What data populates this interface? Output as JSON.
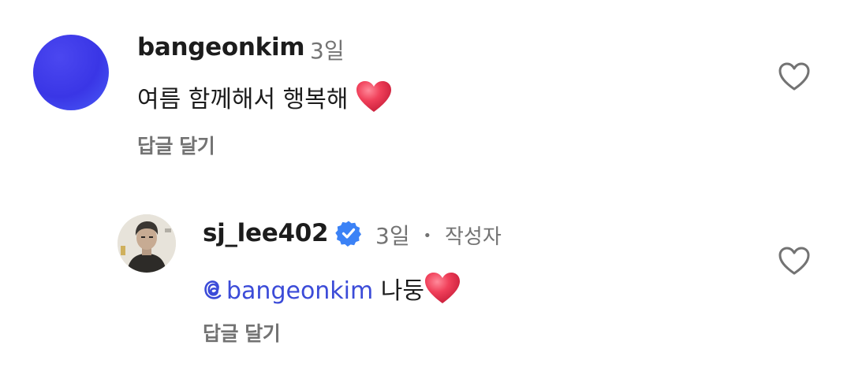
{
  "comments": [
    {
      "username": "bangeonkim",
      "time": "3일",
      "text": "여름 함께해서 행복해",
      "emoji": "heart",
      "reply_label": "답글 달기",
      "avatar_color": "#3b37e8"
    },
    {
      "username": "sj_lee402",
      "verified": true,
      "time": "3일",
      "separator": "•",
      "author_badge": "작성자",
      "mention": "bangeonkim",
      "text": "나둥",
      "emoji": "heart",
      "reply_label": "답글 달기"
    }
  ],
  "colors": {
    "mention": "#3b4bd8",
    "meta": "#737373",
    "verified": "#3b82f6",
    "heart_emoji": "#e8334a"
  },
  "icons": {
    "like": "heart-outline-icon",
    "verified": "verified-badge-icon",
    "mention": "threads-at-icon"
  }
}
